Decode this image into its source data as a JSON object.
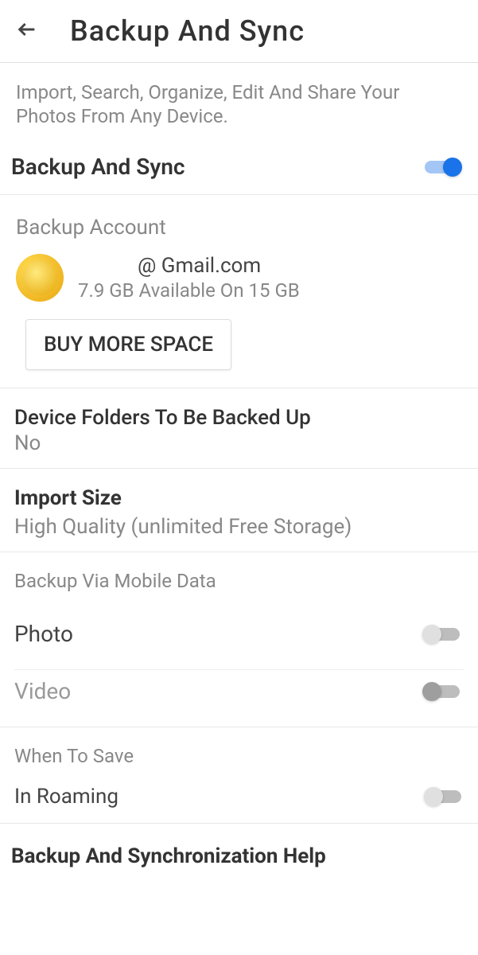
{
  "header": {
    "title": "Backup And Sync"
  },
  "description": "Import, Search, Organize, Edit And Share Your Photos From Any Device.",
  "backup_toggle": {
    "label": "Backup And Sync",
    "enabled": true
  },
  "account": {
    "title": "Backup Account",
    "email": "@ Gmail.com",
    "storage": "7.9 GB Available On 15 GB",
    "buy_button": "BUY MORE SPACE"
  },
  "device_folders": {
    "title": "Device Folders To Be Backed Up",
    "value": "No"
  },
  "import_size": {
    "title": "Import Size",
    "value": "High Quality (unlimited Free Storage)"
  },
  "mobile_data": {
    "title": "Backup Via Mobile Data",
    "photo_label": "Photo",
    "video_label": "Video"
  },
  "when_to_save": {
    "title": "When To Save",
    "label": "In Roaming"
  },
  "help": {
    "title": "Backup And Synchronization Help"
  }
}
